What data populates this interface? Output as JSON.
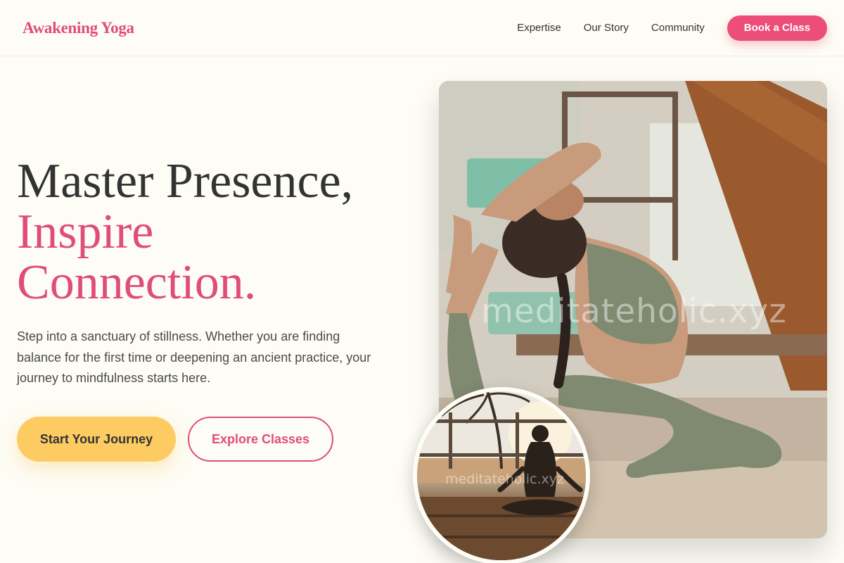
{
  "header": {
    "logo": "Awakening Yoga",
    "nav": [
      {
        "label": "Expertise"
      },
      {
        "label": "Our Story"
      },
      {
        "label": "Community"
      }
    ],
    "cta_label": "Book a Class"
  },
  "hero": {
    "title_line1": "Master Presence,",
    "title_line2": "Inspire",
    "title_line3": "Connection.",
    "description": "Step into a sanctuary of stillness. Whether you are finding balance for the first time or deepening an ancient practice, your journey to mindfulness starts here.",
    "primary_button": "Start Your Journey",
    "secondary_button": "Explore Classes"
  },
  "images": {
    "main_watermark": "meditateholic.xyz",
    "inset_watermark": "meditateholic.xyz"
  },
  "colors": {
    "accent": "#e04d78",
    "button_yellow": "#fdcb62",
    "background": "#fdfcf5",
    "text": "#333333"
  }
}
